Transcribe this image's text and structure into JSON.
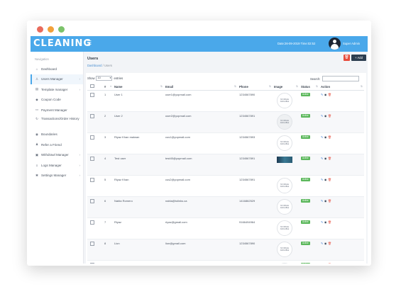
{
  "brand": "CLEANING",
  "header": {
    "datetime": "Date:26-09-2019 Time:02:52",
    "user_name": "Super Admin"
  },
  "sidebar": {
    "heading": "Navigation",
    "items": [
      {
        "label": "Dashboard",
        "icon": "home-icon",
        "active": false,
        "arrow": false
      },
      {
        "label": "Users Manager",
        "icon": "user-icon",
        "active": true,
        "arrow": true
      },
      {
        "label": "Template manager",
        "icon": "template-icon",
        "active": false,
        "arrow": true
      },
      {
        "label": "Coupon Code",
        "icon": "tag-icon",
        "active": false,
        "arrow": false
      },
      {
        "label": "Payment Manager",
        "icon": "card-icon",
        "active": false,
        "arrow": false
      },
      {
        "label": "Transactions/Order History",
        "icon": "refresh-icon",
        "active": false,
        "arrow": false
      },
      {
        "label": "Boundaries",
        "icon": "pin-icon",
        "active": false,
        "arrow": false
      },
      {
        "label": "Refer a Friend",
        "icon": "users-icon",
        "active": false,
        "arrow": false
      },
      {
        "label": "Withdrawl Manager",
        "icon": "wallet-icon",
        "active": false,
        "arrow": true
      },
      {
        "label": "Logs Manager",
        "icon": "logs-icon",
        "active": false,
        "arrow": true
      },
      {
        "label": "Settings Manager",
        "icon": "gear-icon",
        "active": false,
        "arrow": true
      }
    ]
  },
  "page": {
    "title": "Users",
    "breadcrumb_link": "Dashboard",
    "breadcrumb_sep": "/",
    "breadcrumb_current": "Users",
    "delete_label": "🗑",
    "add_label": "+ Add"
  },
  "table_controls": {
    "show_label": "Show",
    "entries_value": "10",
    "entries_label": "entries",
    "search_label": "Search:"
  },
  "table": {
    "columns": [
      "#",
      "Name",
      "Email",
      "Phone",
      "Image",
      "Status",
      "Action"
    ],
    "no_image_text": "NO IMAGE AVAILABLE",
    "rows": [
      {
        "num": "1",
        "name": "User 1",
        "email": "user1@yopmail.com",
        "phone": "1234567890",
        "image": "none",
        "status": "Active"
      },
      {
        "num": "2",
        "name": "User 2",
        "email": "user2@yopmail.com",
        "phone": "1234567891",
        "image": "none-grey",
        "status": "Active"
      },
      {
        "num": "3",
        "name": "Riyaz Khan malwan",
        "email": "cus1@yopmail.com",
        "phone": "1234567893",
        "image": "none",
        "status": "Active"
      },
      {
        "num": "4",
        "name": "Test user",
        "email": "test45@yopmail.com",
        "phone": "1234567891",
        "image": "photo",
        "status": "Active"
      },
      {
        "num": "5",
        "name": "Riyaz Khan",
        "email": "cus2@yopmail.com",
        "phone": "1234567891",
        "image": "none",
        "status": "Active"
      },
      {
        "num": "6",
        "name": "Nabla Romero",
        "email": "nabla@tolinks.ca",
        "phone": "1416862529",
        "image": "none",
        "status": "Active"
      },
      {
        "num": "7",
        "name": "Riyaz",
        "email": "riyaz@gmail.com",
        "phone": "9166494964",
        "image": "none",
        "status": "Active"
      },
      {
        "num": "8",
        "name": "Lion",
        "email": "lion@gmail.com",
        "phone": "1234567890",
        "image": "none",
        "status": "Active"
      },
      {
        "num": "9",
        "name": "Nabla Romero",
        "email": "nabla.tolinksdeliveries@gmail.com",
        "phone": "1416862529",
        "image": "none",
        "status": "Active"
      }
    ]
  },
  "colors": {
    "topbar": "#4aa8ea",
    "active_badge": "#5cb85c",
    "delete_button": "#e74c3c",
    "add_button": "#2c3e50"
  }
}
